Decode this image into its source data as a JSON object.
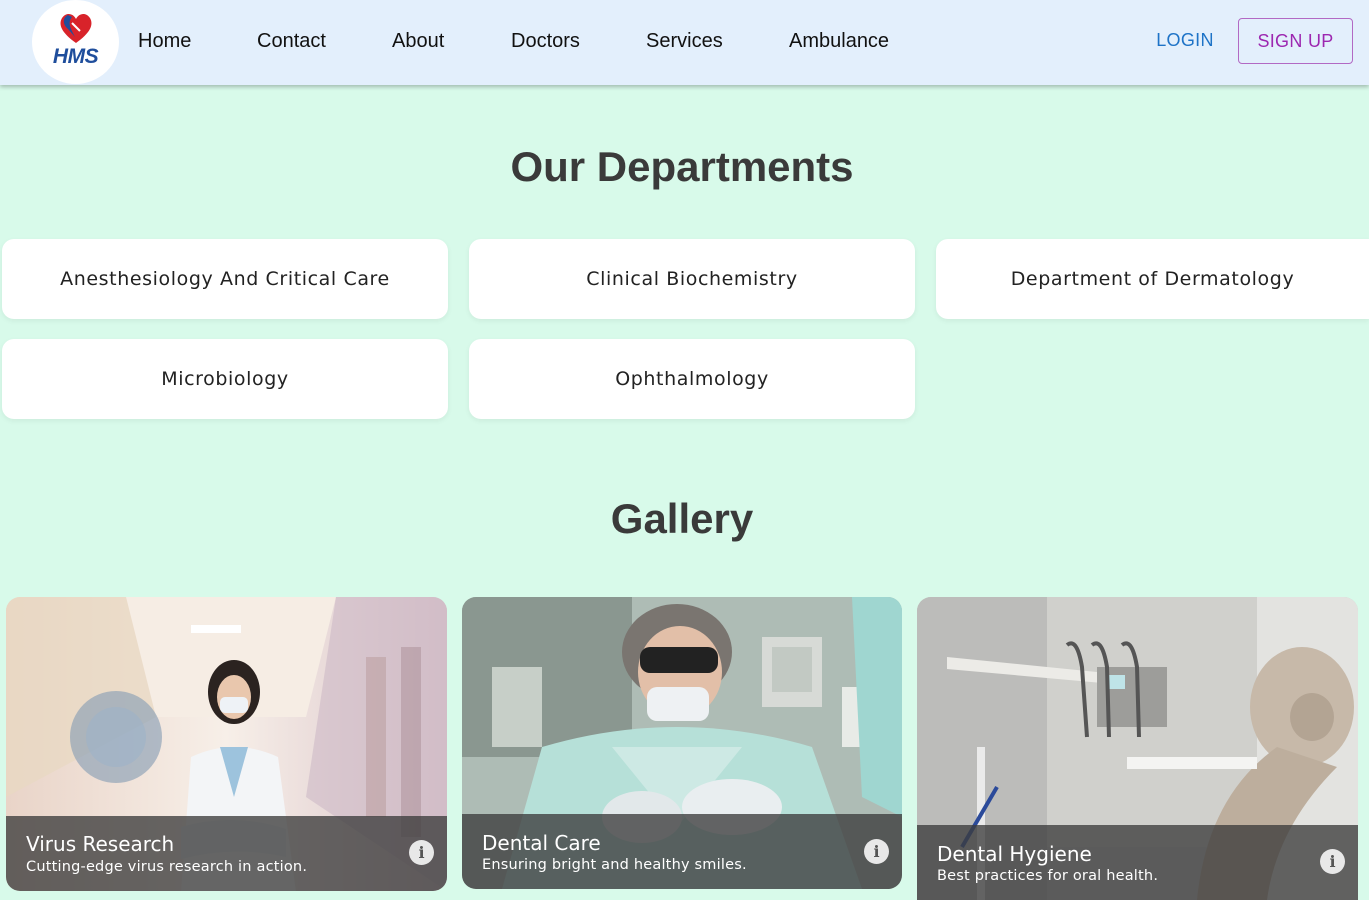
{
  "brand": {
    "logo_text": "HMS"
  },
  "nav": {
    "links": [
      {
        "label": "Home"
      },
      {
        "label": "Contact"
      },
      {
        "label": "About"
      },
      {
        "label": "Doctors"
      },
      {
        "label": "Services"
      },
      {
        "label": "Ambulance"
      }
    ],
    "login_label": "LOGIN",
    "signup_label": "SIGN UP"
  },
  "departments": {
    "title": "Our Departments",
    "items": [
      {
        "label": "Anesthesiology And Critical Care"
      },
      {
        "label": "Clinical Biochemistry"
      },
      {
        "label": "Department of Dermatology"
      },
      {
        "label": "Microbiology"
      },
      {
        "label": "Ophthalmology"
      }
    ]
  },
  "gallery": {
    "title": "Gallery",
    "items": [
      {
        "title": "Virus Research",
        "subtitle": "Cutting-edge virus research in action.",
        "icon": "info-icon"
      },
      {
        "title": "Dental Care",
        "subtitle": "Ensuring bright and healthy smiles.",
        "icon": "info-icon"
      },
      {
        "title": "Dental Hygiene",
        "subtitle": "Best practices for oral health.",
        "icon": "info-icon"
      }
    ]
  },
  "colors": {
    "page_bg": "#d8faea",
    "navbar_bg": "#e3effc",
    "login": "#1e73c7",
    "signup": "#9c27b0",
    "logo_blue": "#1f4e9c",
    "logo_red": "#d8232a"
  }
}
